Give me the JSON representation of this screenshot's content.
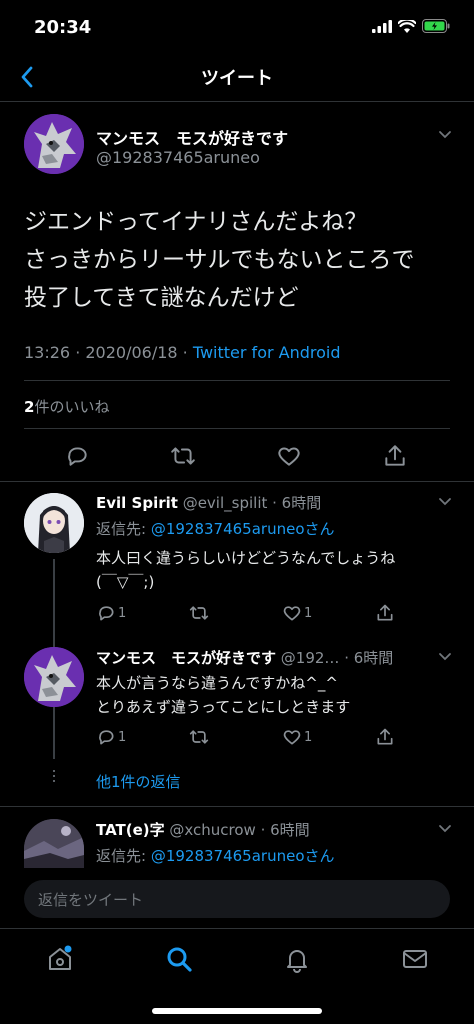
{
  "status": {
    "time": "20:34"
  },
  "nav": {
    "title": "ツイート"
  },
  "tweet": {
    "display_name": "マンモス　モスが好きです",
    "handle": "@192837465aruneo",
    "text_line1": "ジエンドってイナリさんだよね？",
    "text_line2": "さっきからリーサルでもないところで",
    "text_line3": "投了してきて謎なんだけど",
    "time": "13:26 · 2020/06/18 · ",
    "source": "Twitter for Android",
    "likes_count": "2",
    "likes_label": "件のいいね"
  },
  "replies": [
    {
      "display_name": "Evil Spirit",
      "handle": "@evil_spilit · 6時間",
      "reply_to_label": "返信先: ",
      "reply_to_handle": "@192837465aruneoさん",
      "text_line1": "本人曰く違うらしいけどどうなんでしょうね",
      "text_line2": "(￣▽￣;)",
      "reply_count": "1",
      "like_count": "1"
    },
    {
      "display_name": "マンモス　モスが好きです",
      "handle": "@192… · 6時間",
      "text_line1": "本人が言うなら違うんですかね^_^",
      "text_line2": "とりあえず違うってことにしときます",
      "reply_count": "1",
      "like_count": "1"
    },
    {
      "display_name": "TAT(e)字",
      "handle": "@xchucrow · 6時間",
      "reply_to_label": "返信先: ",
      "reply_to_handle": "@192837465aruneoさん"
    }
  ],
  "more_replies": "他1件の返信",
  "compose": {
    "placeholder": "返信をツイート"
  },
  "colors": {
    "accent": "#1d9bf0",
    "background": "#000000",
    "divider": "#2f3336"
  },
  "tabs": [
    "home-icon",
    "search-icon",
    "notifications-icon",
    "messages-icon"
  ]
}
